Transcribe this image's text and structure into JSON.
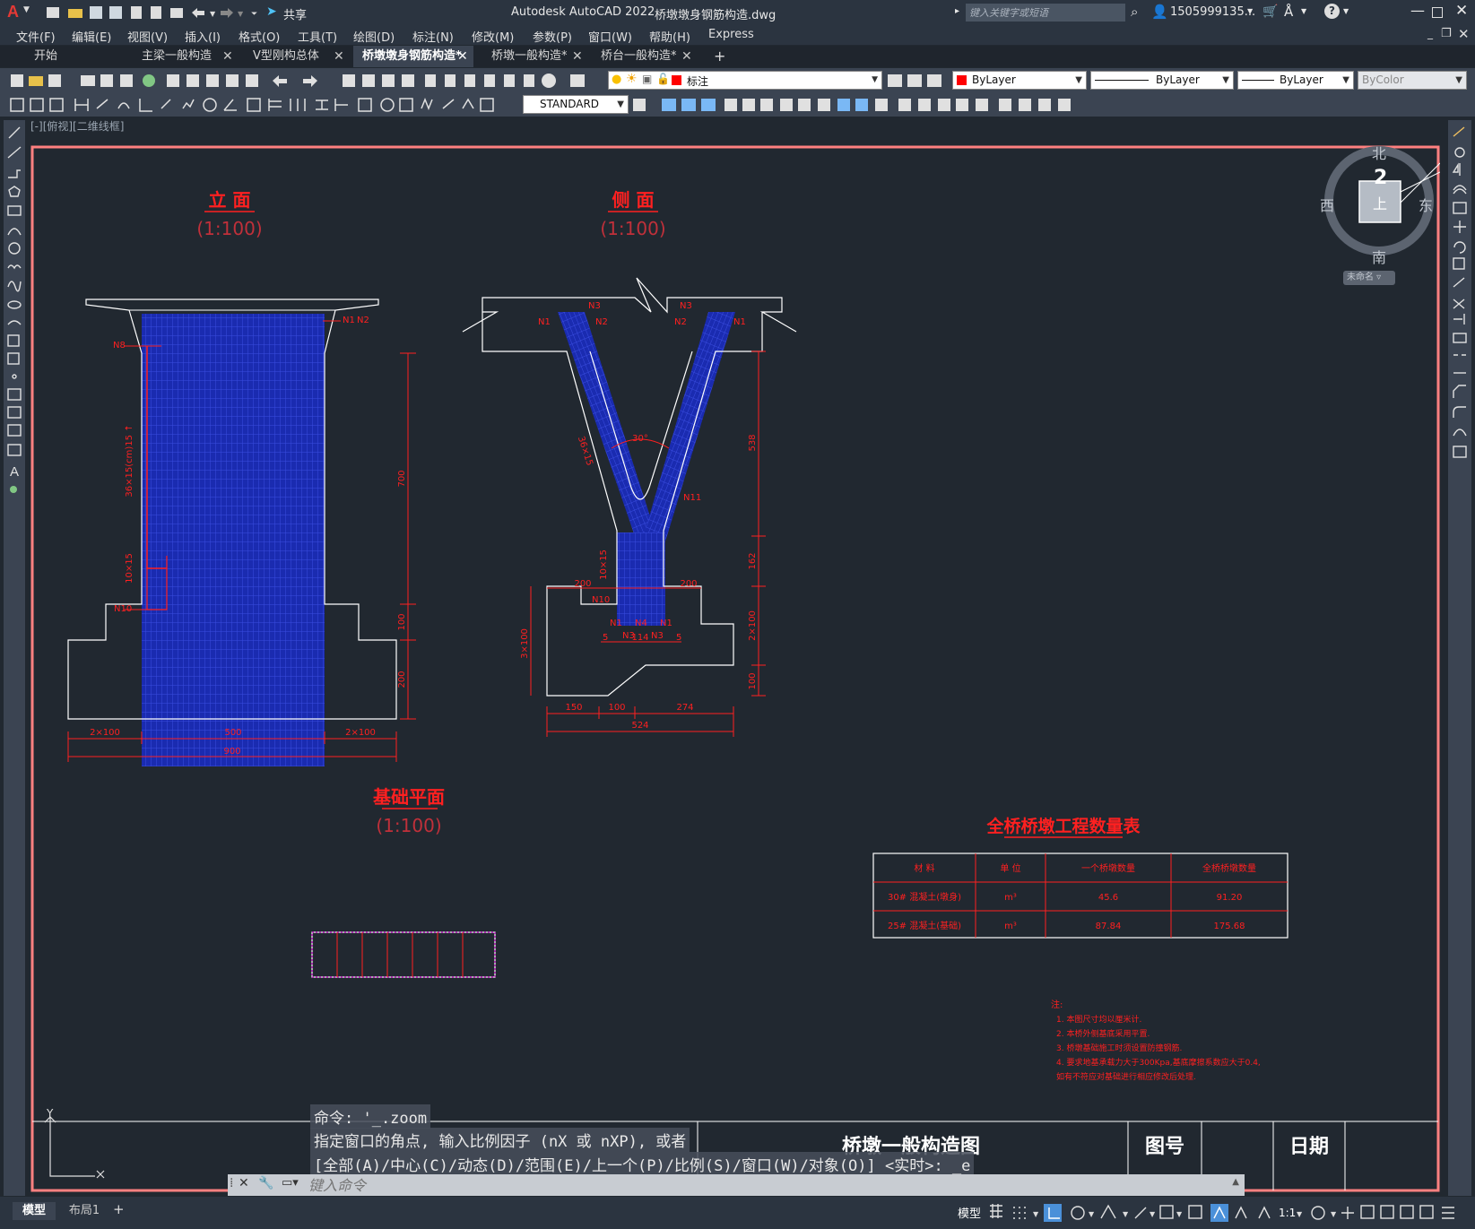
{
  "app": {
    "title": "Autodesk AutoCAD 2022",
    "file_name": "桥墩墩身钢筋构造.dwg",
    "share_label": "共享",
    "search_placeholder": "键入关键字或短语",
    "user": "1505999135...",
    "brand_color": "#d32f2f"
  },
  "menus": [
    "文件(F)",
    "编辑(E)",
    "视图(V)",
    "插入(I)",
    "格式(O)",
    "工具(T)",
    "绘图(D)",
    "标注(N)",
    "修改(M)",
    "参数(P)",
    "窗口(W)",
    "帮助(H)",
    "Express"
  ],
  "tabs": [
    {
      "label": "开始",
      "closable": false,
      "active": false
    },
    {
      "label": "主梁一般构造",
      "closable": true,
      "active": false
    },
    {
      "label": "V型刚构总体",
      "closable": true,
      "active": false
    },
    {
      "label": "桥墩墩身钢筋构造*",
      "closable": true,
      "active": true
    },
    {
      "label": "桥墩一般构造*",
      "closable": true,
      "active": false
    },
    {
      "label": "桥台一般构造*",
      "closable": true,
      "active": false
    }
  ],
  "new_tab_label": "+",
  "toolbar": {
    "layer_name": "标注",
    "color": "ByLayer",
    "linetype": "ByLayer",
    "lineweight": "ByLayer",
    "plotstyle": "ByColor",
    "textstyle": "STANDARD"
  },
  "viewport_label": "[-][俯视][二维线框]",
  "viewcube": {
    "north": "北",
    "south": "南",
    "east": "东",
    "west": "西",
    "face": "上",
    "number": "2",
    "ucs_name": "未命名"
  },
  "drawing": {
    "elev_title": "立 面",
    "elev_scale": "(1:100)",
    "side_title": "侧 面",
    "side_scale": "(1:100)",
    "plan_title": "基础平面",
    "plan_scale": "(1:100)",
    "table_title": "全桥桥墩工程数量表",
    "table_headers": [
      "材 料",
      "单 位",
      "一个桥墩数量",
      "全桥桥墩数量"
    ],
    "table_rows": [
      [
        "30# 混凝土(墩身)",
        "m³",
        "45.6",
        "91.20"
      ],
      [
        "25# 混凝土(基础)",
        "m³",
        "87.84",
        "175.68"
      ]
    ],
    "notes_head": "注:",
    "notes": [
      "1. 本图尺寸均以厘米计.",
      "2. 本桥外侧基底采用平置.",
      "3. 桥墩基础施工时须设置防撞钢筋.",
      "4. 要求地基承载力大于300Kpa,基底摩擦系数应大于0.4,",
      "   如有不符应对基础进行相应修改后处理."
    ],
    "titleblock": {
      "name": "桥墩一般构造图",
      "fig_no": "图号",
      "date": "日期"
    },
    "elev_labels": {
      "n1": "N1",
      "n2": "N2",
      "n8": "N8",
      "n10": "N10",
      "spacing1": "36×15(cm)15 ↑",
      "spacing2": "10×15",
      "d_700": "700",
      "d_100": "100",
      "d_200": "200",
      "d_2x100a": "2×100",
      "d_500": "500",
      "d_2x100b": "2×100",
      "d_900": "900"
    },
    "side_labels": {
      "n1": "N1",
      "n2": "N2",
      "n3": "N3",
      "n4": "N4",
      "n10": "N10",
      "n11": "N11",
      "angle": "30°",
      "sp1": "36×15",
      "sp2": "10×15",
      "d_538": "538",
      "d_162": "162",
      "d_2x100": "2×100",
      "d_100": "100",
      "d_3x100": "3×100",
      "d_200a": "200",
      "d_200b": "200",
      "d_5a": "5",
      "d_114": "114",
      "d_5b": "5",
      "d_150": "150",
      "d_100h": "100",
      "d_274": "274",
      "d_524": "524"
    }
  },
  "command": {
    "line1": "命令: '_.zoom",
    "line2": "指定窗口的角点, 输入比例因子 (nX 或 nXP), 或者",
    "line3": "[全部(A)/中心(C)/动态(D)/范围(E)/上一个(P)/比例(S)/窗口(W)/对象(O)] <实时>: _e",
    "placeholder": "键入命令"
  },
  "status": {
    "model_tab": "模型",
    "layout_tab": "布局1",
    "add_tab": "+",
    "model_label": "模型",
    "scale": "1:1"
  }
}
